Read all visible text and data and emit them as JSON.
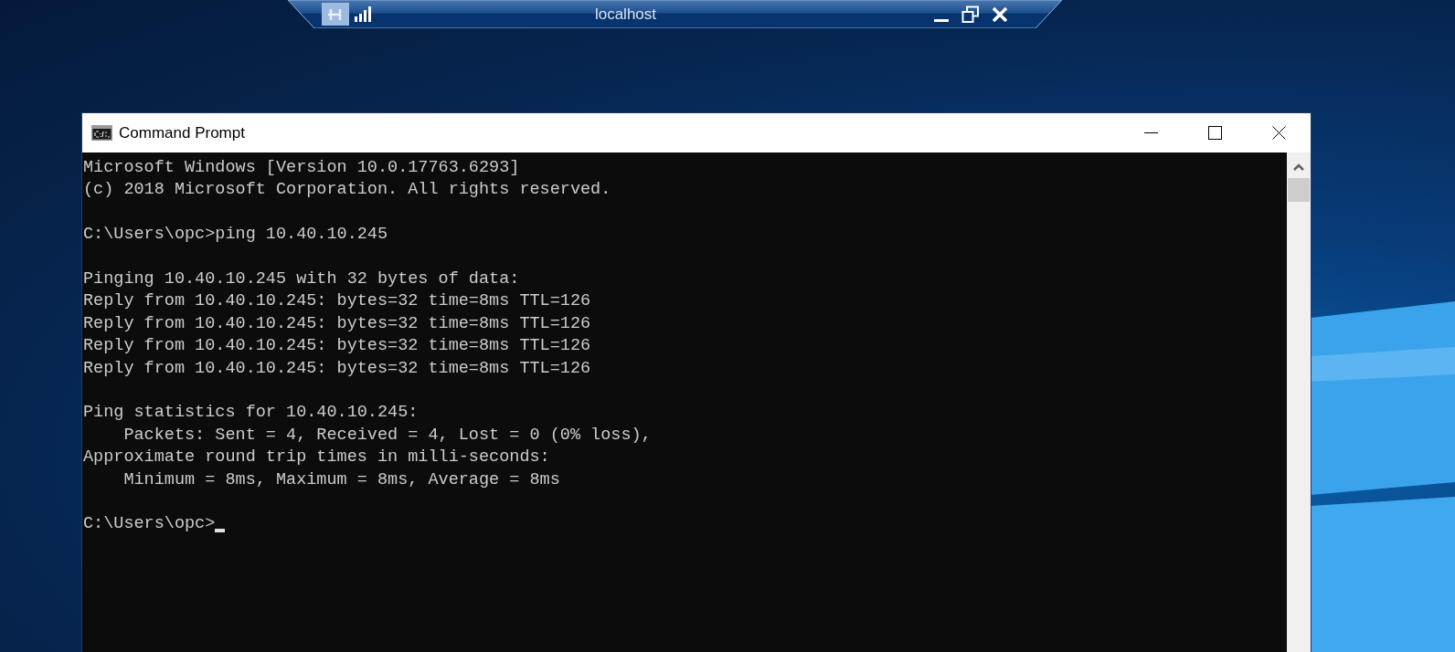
{
  "remote_bar": {
    "title": "localhost"
  },
  "window": {
    "title": "Command Prompt"
  },
  "console": {
    "blocks": [
      [
        "Microsoft Windows [Version 10.0.17763.6293]",
        "(c) 2018 Microsoft Corporation. All rights reserved."
      ],
      [
        "C:\\Users\\opc>ping 10.40.10.245"
      ],
      [
        "Pinging 10.40.10.245 with 32 bytes of data:",
        "Reply from 10.40.10.245: bytes=32 time=8ms TTL=126",
        "Reply from 10.40.10.245: bytes=32 time=8ms TTL=126",
        "Reply from 10.40.10.245: bytes=32 time=8ms TTL=126",
        "Reply from 10.40.10.245: bytes=32 time=8ms TTL=126"
      ],
      [
        "Ping statistics for 10.40.10.245:",
        "    Packets: Sent = 4, Received = 4, Lost = 0 (0% loss),",
        "Approximate round trip times in milli-seconds:",
        "    Minimum = 8ms, Maximum = 8ms, Average = 8ms"
      ]
    ],
    "prompt": "C:\\Users\\opc>"
  }
}
